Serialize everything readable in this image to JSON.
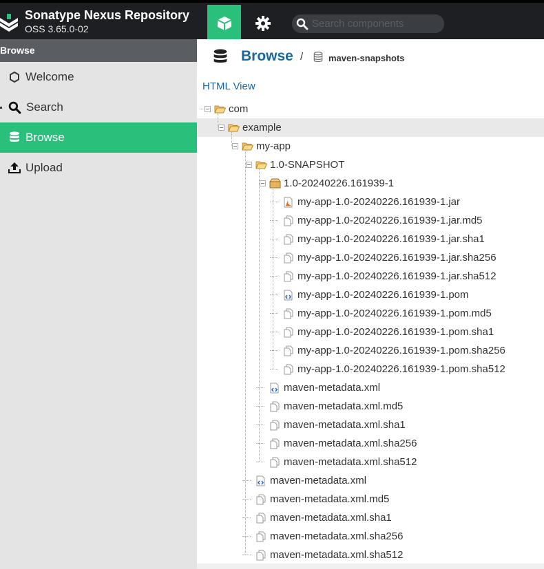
{
  "header": {
    "title": "Sonatype Nexus Repository",
    "version": "OSS 3.65.0-02",
    "search_placeholder": "Search components",
    "colors": {
      "bar": "#1d1f22",
      "accent": "#2abf7b"
    }
  },
  "sidebar": {
    "header": "Browse",
    "items": [
      {
        "label": "Welcome",
        "icon": "hexagon-icon",
        "active": false
      },
      {
        "label": "Search",
        "icon": "search-icon",
        "active": false
      },
      {
        "label": "Browse",
        "icon": "database-icon",
        "active": true
      },
      {
        "label": "Upload",
        "icon": "upload-icon",
        "active": false
      }
    ]
  },
  "breadcrumb": {
    "title": "Browse",
    "separator": "/",
    "repository": "maven-snapshots"
  },
  "html_view_link": "HTML View",
  "tree": [
    {
      "label": "com",
      "type": "folder-open",
      "depth": 0,
      "expander": true
    },
    {
      "label": "example",
      "type": "folder-open",
      "depth": 1,
      "expander": true,
      "highlighted": true
    },
    {
      "label": "my-app",
      "type": "folder-open",
      "depth": 2,
      "expander": true
    },
    {
      "label": "1.0-SNAPSHOT",
      "type": "folder-open",
      "depth": 3,
      "expander": true
    },
    {
      "label": "1.0-20240226.161939-1",
      "type": "package",
      "depth": 4,
      "expander": true
    },
    {
      "label": "my-app-1.0-20240226.161939-1.jar",
      "type": "jar",
      "depth": 5
    },
    {
      "label": "my-app-1.0-20240226.161939-1.jar.md5",
      "type": "file",
      "depth": 5
    },
    {
      "label": "my-app-1.0-20240226.161939-1.jar.sha1",
      "type": "file",
      "depth": 5
    },
    {
      "label": "my-app-1.0-20240226.161939-1.jar.sha256",
      "type": "file",
      "depth": 5
    },
    {
      "label": "my-app-1.0-20240226.161939-1.jar.sha512",
      "type": "file",
      "depth": 5
    },
    {
      "label": "my-app-1.0-20240226.161939-1.pom",
      "type": "xml",
      "depth": 5
    },
    {
      "label": "my-app-1.0-20240226.161939-1.pom.md5",
      "type": "file",
      "depth": 5
    },
    {
      "label": "my-app-1.0-20240226.161939-1.pom.sha1",
      "type": "file",
      "depth": 5
    },
    {
      "label": "my-app-1.0-20240226.161939-1.pom.sha256",
      "type": "file",
      "depth": 5
    },
    {
      "label": "my-app-1.0-20240226.161939-1.pom.sha512",
      "type": "file",
      "depth": 5
    },
    {
      "label": "maven-metadata.xml",
      "type": "xml",
      "depth": 4
    },
    {
      "label": "maven-metadata.xml.md5",
      "type": "file",
      "depth": 4
    },
    {
      "label": "maven-metadata.xml.sha1",
      "type": "file",
      "depth": 4
    },
    {
      "label": "maven-metadata.xml.sha256",
      "type": "file",
      "depth": 4
    },
    {
      "label": "maven-metadata.xml.sha512",
      "type": "file",
      "depth": 4
    },
    {
      "label": "maven-metadata.xml",
      "type": "xml",
      "depth": 3
    },
    {
      "label": "maven-metadata.xml.md5",
      "type": "file",
      "depth": 3
    },
    {
      "label": "maven-metadata.xml.sha1",
      "type": "file",
      "depth": 3
    },
    {
      "label": "maven-metadata.xml.sha256",
      "type": "file",
      "depth": 3
    },
    {
      "label": "maven-metadata.xml.sha512",
      "type": "file",
      "depth": 3
    }
  ]
}
